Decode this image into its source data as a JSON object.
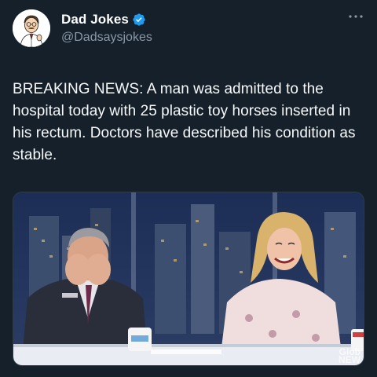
{
  "tweet": {
    "author": {
      "display_name": "Dad Jokes",
      "handle": "@Dadsaysjokes",
      "verified": true,
      "avatar_icon": "cartoon-dad-avatar"
    },
    "more_icon": "more-options-icon",
    "text": "BREAKING NEWS: A man was admitted to the hospital today with 25 plastic toy horses inserted in his rectum. Doctors have described his condition as stable.",
    "media": {
      "description_icon": "news-anchors-laughing-image",
      "watermark_line1": "Glob",
      "watermark_line2": "NEW"
    }
  },
  "colors": {
    "background": "#15202b",
    "text": "#f7f9f9",
    "secondary_text": "#8b98a5",
    "verified_badge": "#1d9bf0"
  }
}
